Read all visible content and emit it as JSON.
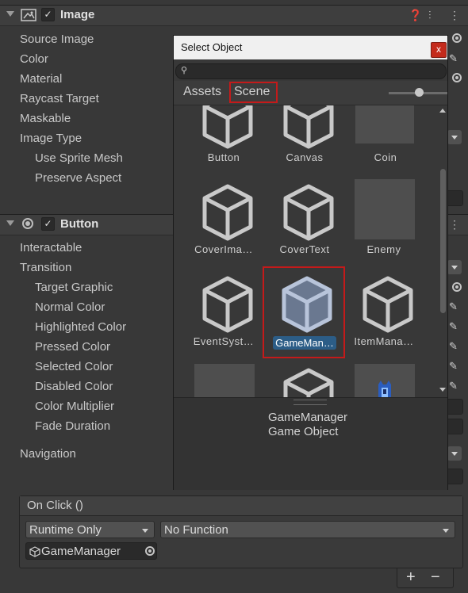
{
  "image_component": {
    "title": "Image",
    "properties": [
      "Source Image",
      "Color",
      "Material",
      "Raycast Target",
      "Maskable",
      "Image Type",
      "Use Sprite Mesh",
      "Preserve Aspect"
    ]
  },
  "button_component": {
    "title": "Button",
    "properties": [
      "Interactable",
      "Transition",
      "Target Graphic",
      "Normal Color",
      "Highlighted Color",
      "Pressed Color",
      "Selected Color",
      "Disabled Color",
      "Color Multiplier",
      "Fade Duration",
      "Navigation"
    ]
  },
  "on_click": {
    "title": "On Click ()",
    "runtime_option": "Runtime Only",
    "function_option": "No Function",
    "target_object": "GameManager",
    "add_label": "+",
    "remove_label": "−"
  },
  "picker": {
    "title": "Select Object",
    "close_label": "x",
    "search_placeholder": "",
    "tabs": [
      "Assets",
      "Scene"
    ],
    "active_tab": "Scene",
    "items": [
      {
        "label": "Button",
        "kind": "cube"
      },
      {
        "label": "Canvas",
        "kind": "cube"
      },
      {
        "label": "Coin",
        "kind": "thumb"
      },
      {
        "label": "CoverIma…",
        "kind": "cube"
      },
      {
        "label": "CoverText",
        "kind": "cube"
      },
      {
        "label": "Enemy",
        "kind": "thumb"
      },
      {
        "label": "EventSyst…",
        "kind": "cube"
      },
      {
        "label": "GameMan…",
        "kind": "cube",
        "selected": true
      },
      {
        "label": "ItemMana…",
        "kind": "cube"
      },
      {
        "label": "",
        "kind": "thumb"
      },
      {
        "label": "",
        "kind": "cube"
      },
      {
        "label": "",
        "kind": "sprite"
      }
    ],
    "preview": {
      "name": "GameManager",
      "type": "Game Object"
    }
  },
  "colors": {
    "selection": "#2c5d87",
    "highlight_border": "#c41a1a",
    "panel": "#383838"
  }
}
